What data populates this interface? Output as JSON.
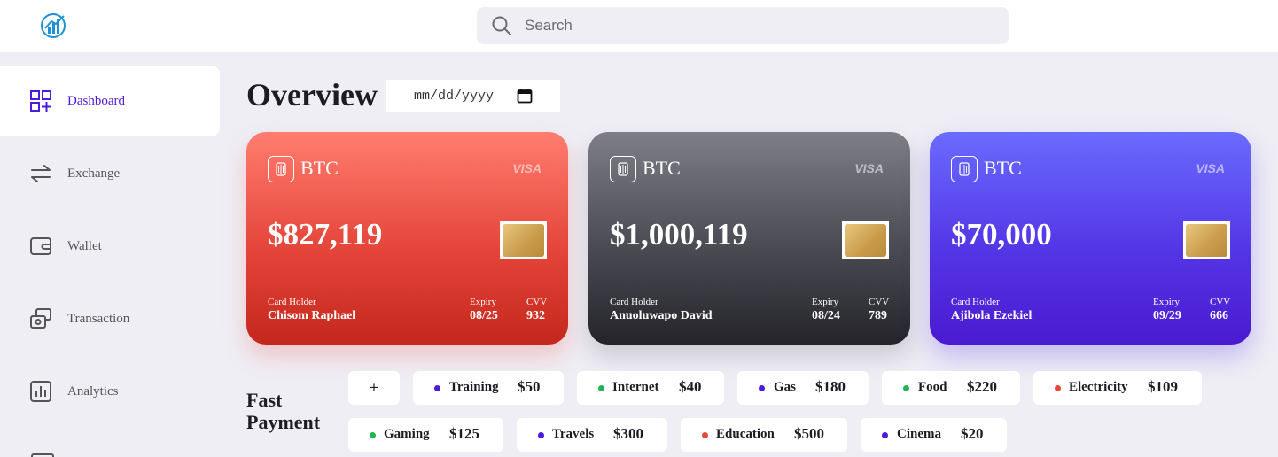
{
  "search": {
    "placeholder": "Search"
  },
  "sidebar": {
    "items": [
      {
        "label": "Dashboard",
        "icon": "dashboard-icon",
        "active": true
      },
      {
        "label": "Exchange",
        "icon": "exchange-icon"
      },
      {
        "label": "Wallet",
        "icon": "wallet-icon"
      },
      {
        "label": "Transaction",
        "icon": "transaction-icon"
      },
      {
        "label": "Analytics",
        "icon": "analytics-icon"
      }
    ]
  },
  "overview": {
    "title": "Overview",
    "date_placeholder": "mm/dd/yyyy"
  },
  "cards": [
    {
      "coin": "BTC",
      "brand": "VISA",
      "amount": "$827,119",
      "holder_label": "Card Holder",
      "holder": "Chisom Raphael",
      "expiry_label": "Expiry",
      "expiry": "08/25",
      "cvv_label": "CVV",
      "cvv": "932",
      "color": "#e5453a"
    },
    {
      "coin": "BTC",
      "brand": "VISA",
      "amount": "$1,000,119",
      "holder_label": "Card Holder",
      "holder": "Anuoluwapo David",
      "expiry_label": "Expiry",
      "expiry": "08/24",
      "cvv_label": "CVV",
      "cvv": "789",
      "color": "#4a4a52"
    },
    {
      "coin": "BTC",
      "brand": "VISA",
      "amount": "$70,000",
      "holder_label": "Card Holder",
      "holder": "Ajibola Ezekiel",
      "expiry_label": "Expiry",
      "expiry": "09/29",
      "cvv_label": "CVV",
      "cvv": "666",
      "color": "#5436e6"
    }
  ],
  "fast_payment": {
    "title_line1": "Fast",
    "title_line2": "Payment",
    "add_label": "+",
    "payments": [
      {
        "name": "Training",
        "amount": "$50",
        "dot": "#4c1bdc"
      },
      {
        "name": "Internet",
        "amount": "$40",
        "dot": "#22b455"
      },
      {
        "name": "Gas",
        "amount": "$180",
        "dot": "#4c1bdc"
      },
      {
        "name": "Food",
        "amount": "$220",
        "dot": "#22b455"
      },
      {
        "name": "Electricity",
        "amount": "$109",
        "dot": "#e8473b"
      },
      {
        "name": "Gaming",
        "amount": "$125",
        "dot": "#22b455"
      },
      {
        "name": "Travels",
        "amount": "$300",
        "dot": "#4c1bdc"
      },
      {
        "name": "Education",
        "amount": "$500",
        "dot": "#e8473b"
      },
      {
        "name": "Cinema",
        "amount": "$20",
        "dot": "#4c1bdc"
      }
    ]
  }
}
